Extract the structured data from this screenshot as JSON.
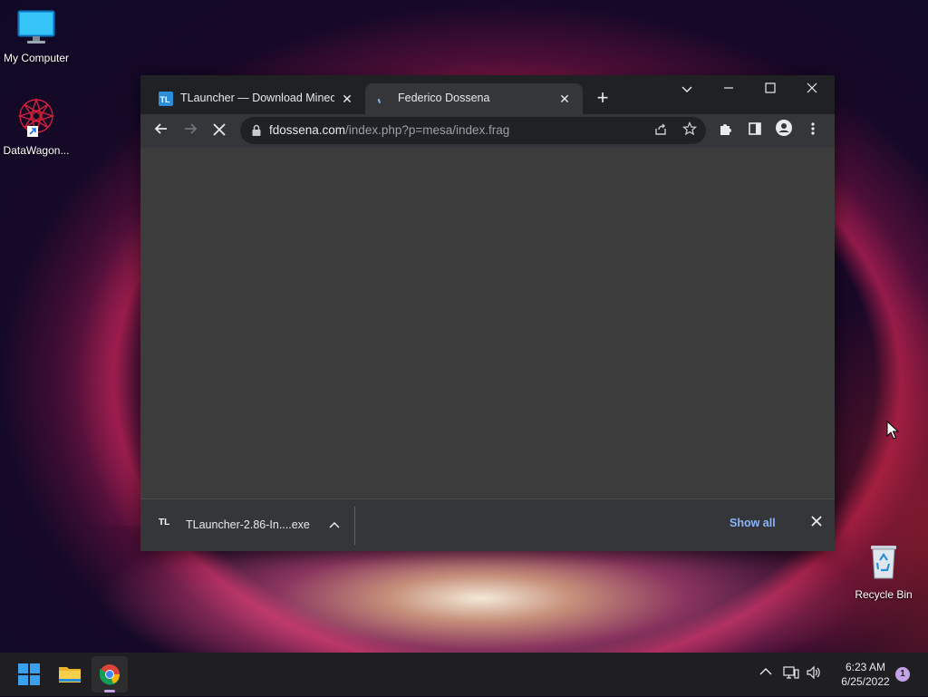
{
  "desktop": {
    "icons": [
      {
        "label": "My Computer",
        "icon": "monitor-icon"
      },
      {
        "label": "DataWagon...",
        "icon": "datawagon-shortcut-icon"
      },
      {
        "label": "Recycle Bin",
        "icon": "recycle-bin-icon"
      }
    ]
  },
  "browser": {
    "tabs": [
      {
        "title": "TLauncher — Download Minecraft",
        "favicon": "TL",
        "active": false
      },
      {
        "title": "Federico Dossena",
        "favicon": "loading-spinner-icon",
        "active": true
      }
    ],
    "new_tab": "+",
    "window_controls": {
      "tab_search": "tab-search-icon",
      "minimize": "minimize-icon",
      "maximize": "maximize-icon",
      "close": "close-icon"
    },
    "address": {
      "host": "fdossena.com",
      "path": "/index.php?p=mesa/index.frag"
    }
  },
  "download_bar": {
    "item": {
      "favicon": "TL",
      "filename": "TLauncher-2.86-In....exe"
    },
    "show_all": "Show all"
  },
  "taskbar": {
    "clock_time": "6:23 AM",
    "clock_date": "6/25/2022",
    "notification_count": "1"
  },
  "colors": {
    "chrome_frame": "#202124",
    "chrome_toolbar": "#35363a",
    "content_bg": "#3c3c3c",
    "link_blue": "#8ab4f8",
    "taskbar": "#1f1f22"
  }
}
